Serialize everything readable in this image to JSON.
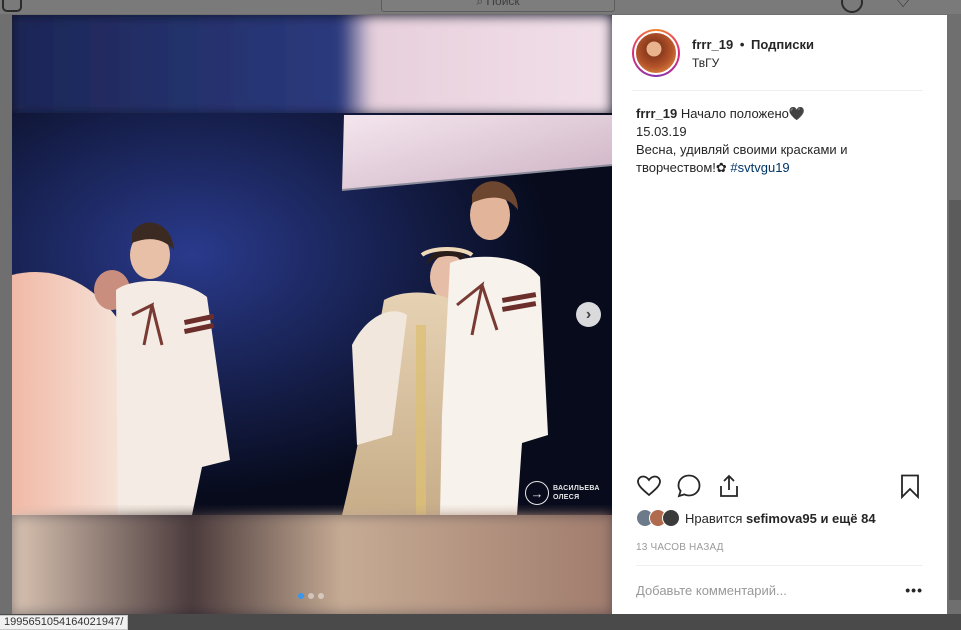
{
  "search": {
    "placeholder": "Поиск",
    "icon": "search-icon"
  },
  "post": {
    "username": "frrr_19",
    "separator": "•",
    "follow_label": "Подписки",
    "location": "ТвГУ",
    "caption": {
      "username": "frrr_19",
      "line1": "Начало положено🖤",
      "line2": "15.03.19",
      "line3": "Весна, удивляй своими красками и",
      "line4": "творчеством!✿ ",
      "hashtag": "#svtvgu19"
    },
    "photo": {
      "description": "Stage photo of folk-costume dancers",
      "watermark_line1": "ВАСИЛЬЕВА",
      "watermark_line2": "ОЛЕСЯ",
      "carousel_total": 3,
      "carousel_active": 1,
      "next_icon": "chevron-right-icon"
    },
    "likes": {
      "prefix": "Нравится",
      "user": "sefimova95",
      "suffix": "и ещё 84"
    },
    "time": "13 ЧАСОВ НАЗАД",
    "comment_placeholder": "Добавьте комментарий...",
    "more_label": "•••"
  },
  "status_url": "19956510541640219​47/",
  "colors": {
    "accent": "#3897f0",
    "hashtag": "#003569",
    "muted": "#999999"
  }
}
